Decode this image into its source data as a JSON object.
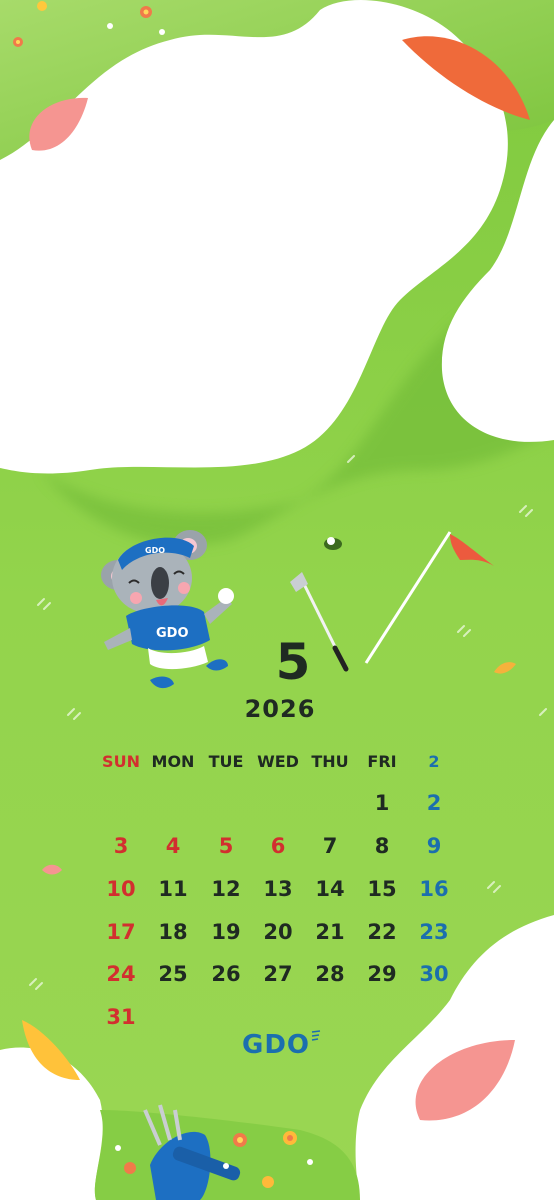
{
  "calendar": {
    "month": "5",
    "year": "2026",
    "weekdays": [
      "SUN",
      "MON",
      "TUE",
      "WED",
      "THU",
      "FRI",
      "2"
    ],
    "rows": [
      [
        "",
        "",
        "",
        "",
        "",
        "1",
        "2"
      ],
      [
        "3",
        "4",
        "5",
        "6",
        "7",
        "8",
        "9"
      ],
      [
        "10",
        "11",
        "12",
        "13",
        "14",
        "15",
        "16"
      ],
      [
        "17",
        "18",
        "19",
        "20",
        "21",
        "22",
        "23"
      ],
      [
        "24",
        "25",
        "26",
        "27",
        "28",
        "29",
        "30"
      ],
      [
        "31",
        "",
        "",
        "",
        "",
        "",
        ""
      ]
    ],
    "holidays": [
      "3",
      "4",
      "5",
      "6"
    ]
  },
  "mascot": {
    "cap_text": "GDO",
    "shirt_text": "GDO"
  },
  "brand": {
    "logo_text": "GDO"
  },
  "colors": {
    "grass": "#8fd24a",
    "grass_dark": "#6cbe35",
    "sunday_red": "#d22f2f",
    "saturday_blue": "#1b6fae",
    "text": "#1f2a22",
    "flag": "#ec5a3e",
    "petal_pink": "#f48f8a",
    "brand_blue": "#1b6fae"
  },
  "icons": [
    "koala-mascot-icon",
    "golf-club-icon",
    "golf-hole-icon",
    "flag-pin-icon",
    "golf-bag-icon",
    "petal-icon"
  ]
}
